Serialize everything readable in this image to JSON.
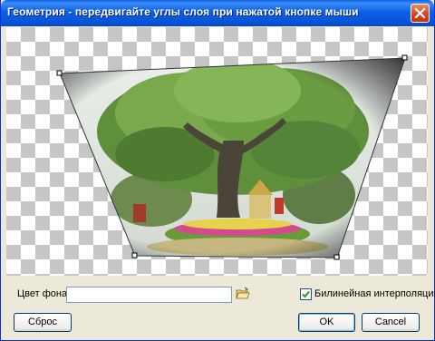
{
  "window": {
    "title": "Геометрия - передвигайте углы слоя при нажатой кнопке мыши"
  },
  "background": {
    "label": "Цвет фона",
    "value": ""
  },
  "interpolation": {
    "label": "Билинейная интерполяция",
    "checked": true
  },
  "buttons": {
    "reset": "Сброс",
    "ok": "OK",
    "cancel": "Cancel"
  },
  "colors": {
    "titlebar": "#0a5fe6",
    "dialog_bg": "#ece9d8",
    "close_button": "#d8461f"
  },
  "icons": {
    "close": "close-icon",
    "folder": "folder-open-icon",
    "check": "checkmark-icon"
  }
}
